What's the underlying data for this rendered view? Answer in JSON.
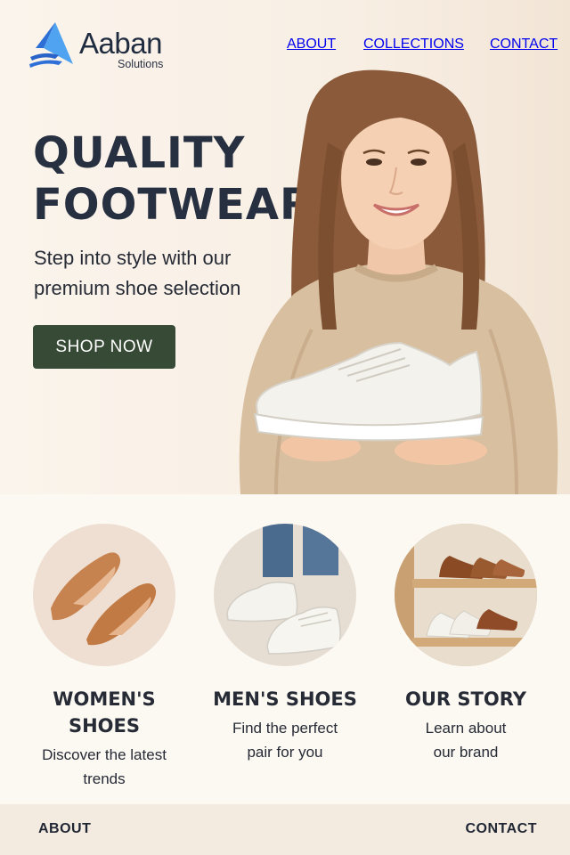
{
  "brand": {
    "name": "Aaban",
    "tagline": "Solutions"
  },
  "nav": {
    "items": [
      "ABOUT",
      "COLLECTIONS",
      "CONTACT"
    ]
  },
  "hero": {
    "title_line1": "QUALITY",
    "title_line2": "FOOTWEAR",
    "subtitle": "Step into style with our premium shoe selection",
    "cta": "SHOP NOW"
  },
  "categories": [
    {
      "title": "WOMEN'S SHOES",
      "description": "Discover the latest trends",
      "image_icon": "womens-flats-image"
    },
    {
      "title": "MEN'S SHOES",
      "description": "Find the perfect pair for you",
      "image_icon": "mens-sneakers-image"
    },
    {
      "title": "OUR STORY",
      "description": "Learn about our brand",
      "image_icon": "shoe-shelf-image"
    }
  ],
  "footer": {
    "left_link": "ABOUT",
    "right_link": "CONTACT"
  },
  "colors": {
    "background": "#fbf6ef",
    "heading": "#273040",
    "cta_background": "#374a35",
    "cta_text": "#ffffff",
    "footer_background": "#f3ebe0",
    "logo_blue": "#2f6fd8"
  }
}
